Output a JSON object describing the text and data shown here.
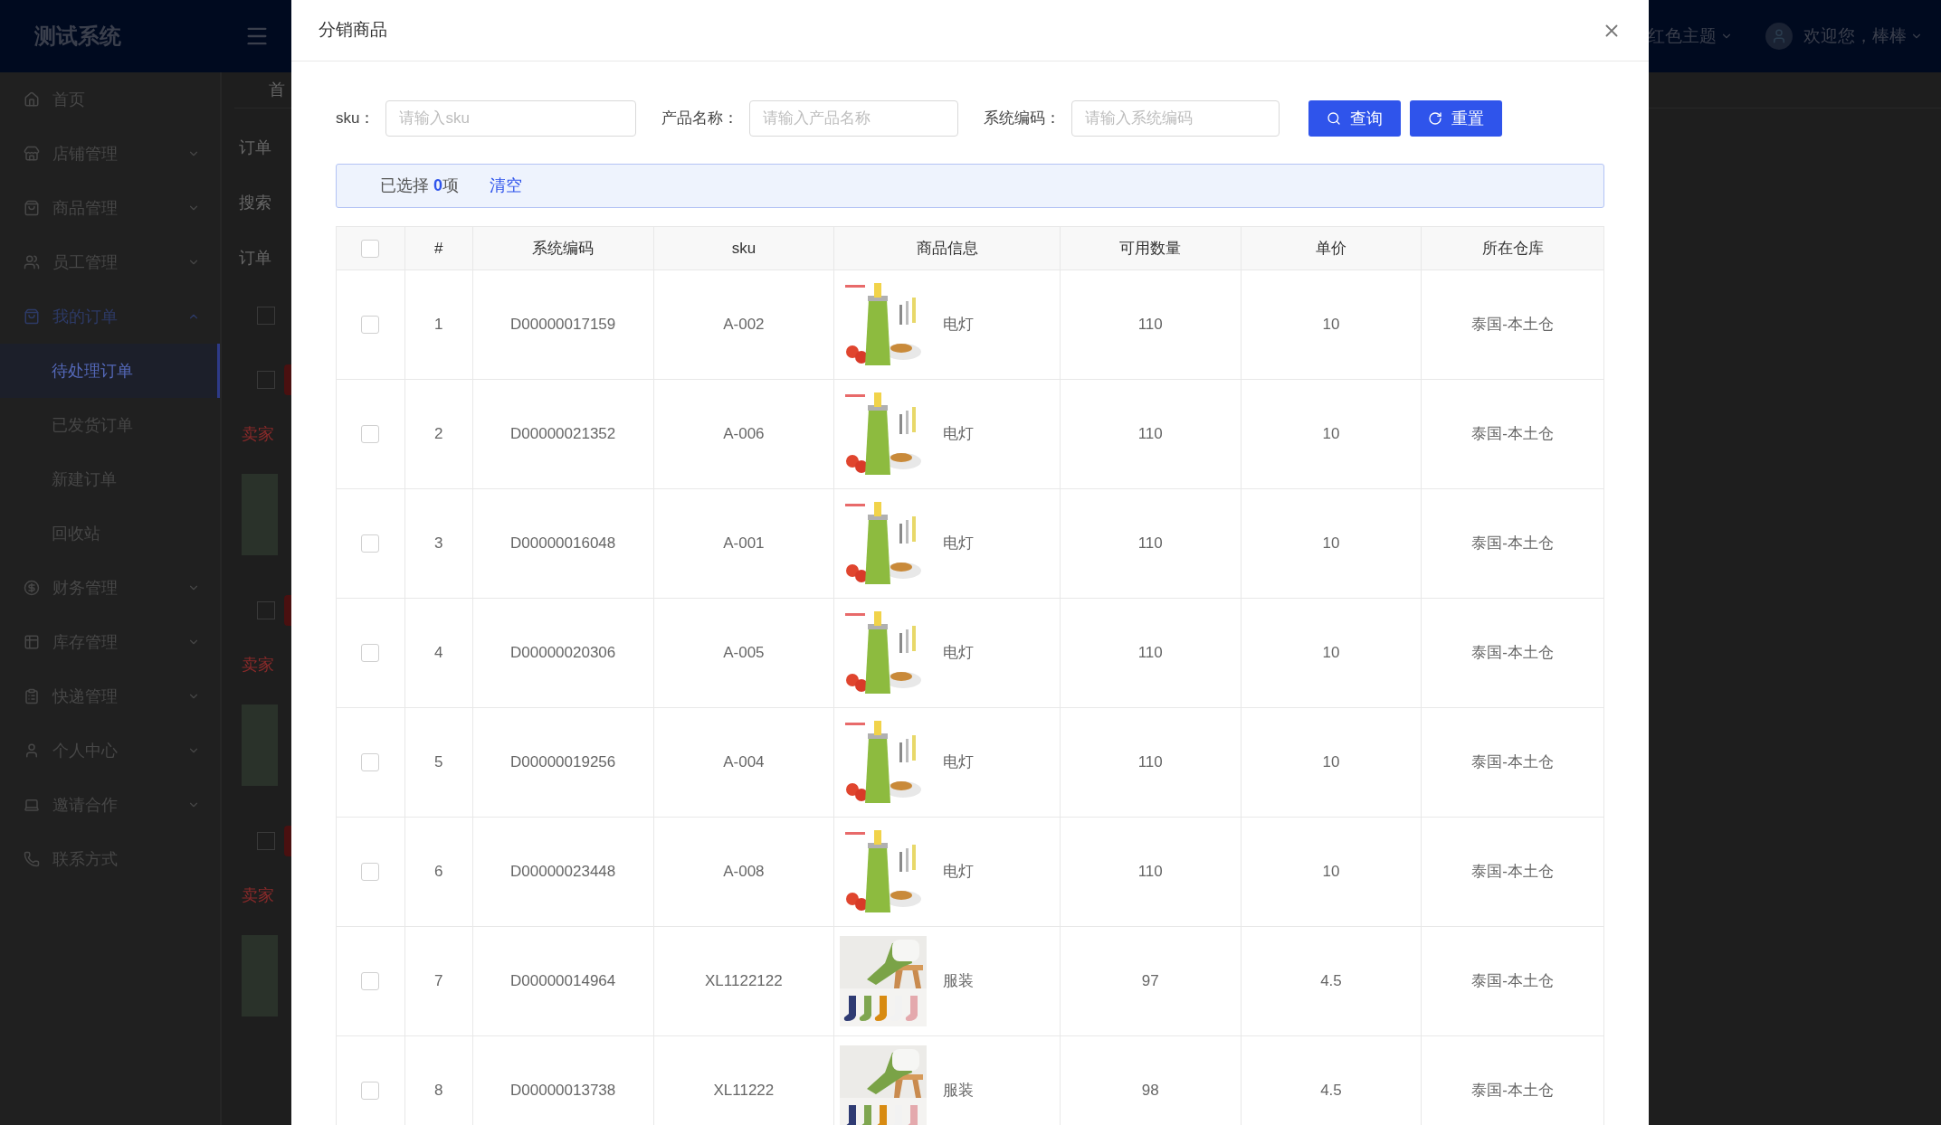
{
  "app": {
    "logo": "测试系统",
    "theme_menu": "红色主题",
    "user_menu": "欢迎您，棒棒"
  },
  "sidebar": {
    "items": [
      {
        "label": "首页",
        "kind": "link"
      },
      {
        "label": "店铺管理",
        "kind": "group",
        "expanded": false
      },
      {
        "label": "商品管理",
        "kind": "group",
        "expanded": false
      },
      {
        "label": "员工管理",
        "kind": "group",
        "expanded": false
      },
      {
        "label": "我的订单",
        "kind": "group",
        "expanded": true,
        "children": [
          {
            "label": "待处理订单",
            "selected": true
          },
          {
            "label": "已发货订单",
            "selected": false
          },
          {
            "label": "新建订单",
            "selected": false
          },
          {
            "label": "回收站",
            "selected": false
          }
        ]
      },
      {
        "label": "财务管理",
        "kind": "group",
        "expanded": false
      },
      {
        "label": "库存管理",
        "kind": "group",
        "expanded": false
      },
      {
        "label": "快递管理",
        "kind": "group",
        "expanded": false
      },
      {
        "label": "个人中心",
        "kind": "group",
        "expanded": false
      },
      {
        "label": "邀请合作",
        "kind": "group",
        "expanded": false
      },
      {
        "label": "联系方式",
        "kind": "link"
      }
    ]
  },
  "background_page": {
    "breadcrumb": "首",
    "filters": [
      "订单",
      "搜索",
      "订单"
    ],
    "select_all_checked": false,
    "orders": [
      {
        "checked": false,
        "note": "卖家"
      },
      {
        "checked": false,
        "note": "卖家"
      },
      {
        "checked": false,
        "note": "卖家"
      }
    ]
  },
  "dialog": {
    "title": "分销商品",
    "search_fields": [
      {
        "label": "sku：",
        "placeholder": "请输入sku"
      },
      {
        "label": "产品名称：",
        "placeholder": "请输入产品名称"
      },
      {
        "label": "系统编码：",
        "placeholder": "请输入系统编码"
      }
    ],
    "buttons": [
      {
        "label": "查询",
        "kind": "search"
      },
      {
        "label": "重置",
        "kind": "reset"
      }
    ],
    "selection": {
      "prefix": "已选择",
      "count": "0",
      "suffix": "项",
      "clear": "清空"
    },
    "table": {
      "all_checked": false,
      "columns": [
        "#",
        "系统编码",
        "sku",
        "商品信息",
        "可用数量",
        "单价",
        "所在仓库"
      ],
      "rows": [
        {
          "checked": false,
          "index": "1",
          "code": "D00000017159",
          "sku": "A-002",
          "kind": "lamp",
          "product": "电灯",
          "qty": "110",
          "price": "10",
          "warehouse": "泰国-本土仓"
        },
        {
          "checked": false,
          "index": "2",
          "code": "D00000021352",
          "sku": "A-006",
          "kind": "lamp",
          "product": "电灯",
          "qty": "110",
          "price": "10",
          "warehouse": "泰国-本土仓"
        },
        {
          "checked": false,
          "index": "3",
          "code": "D00000016048",
          "sku": "A-001",
          "kind": "lamp",
          "product": "电灯",
          "qty": "110",
          "price": "10",
          "warehouse": "泰国-本土仓"
        },
        {
          "checked": false,
          "index": "4",
          "code": "D00000020306",
          "sku": "A-005",
          "kind": "lamp",
          "product": "电灯",
          "qty": "110",
          "price": "10",
          "warehouse": "泰国-本土仓"
        },
        {
          "checked": false,
          "index": "5",
          "code": "D00000019256",
          "sku": "A-004",
          "kind": "lamp",
          "product": "电灯",
          "qty": "110",
          "price": "10",
          "warehouse": "泰国-本土仓"
        },
        {
          "checked": false,
          "index": "6",
          "code": "D00000023448",
          "sku": "A-008",
          "kind": "lamp",
          "product": "电灯",
          "qty": "110",
          "price": "10",
          "warehouse": "泰国-本土仓"
        },
        {
          "checked": false,
          "index": "7",
          "code": "D00000014964",
          "sku": "XL1122122",
          "kind": "socks",
          "product": "服装",
          "qty": "97",
          "price": "4.5",
          "warehouse": "泰国-本土仓"
        },
        {
          "checked": false,
          "index": "8",
          "code": "D00000013738",
          "sku": "XL11222",
          "kind": "socks",
          "product": "服装",
          "qty": "98",
          "price": "4.5",
          "warehouse": "泰国-本土仓"
        }
      ]
    }
  }
}
